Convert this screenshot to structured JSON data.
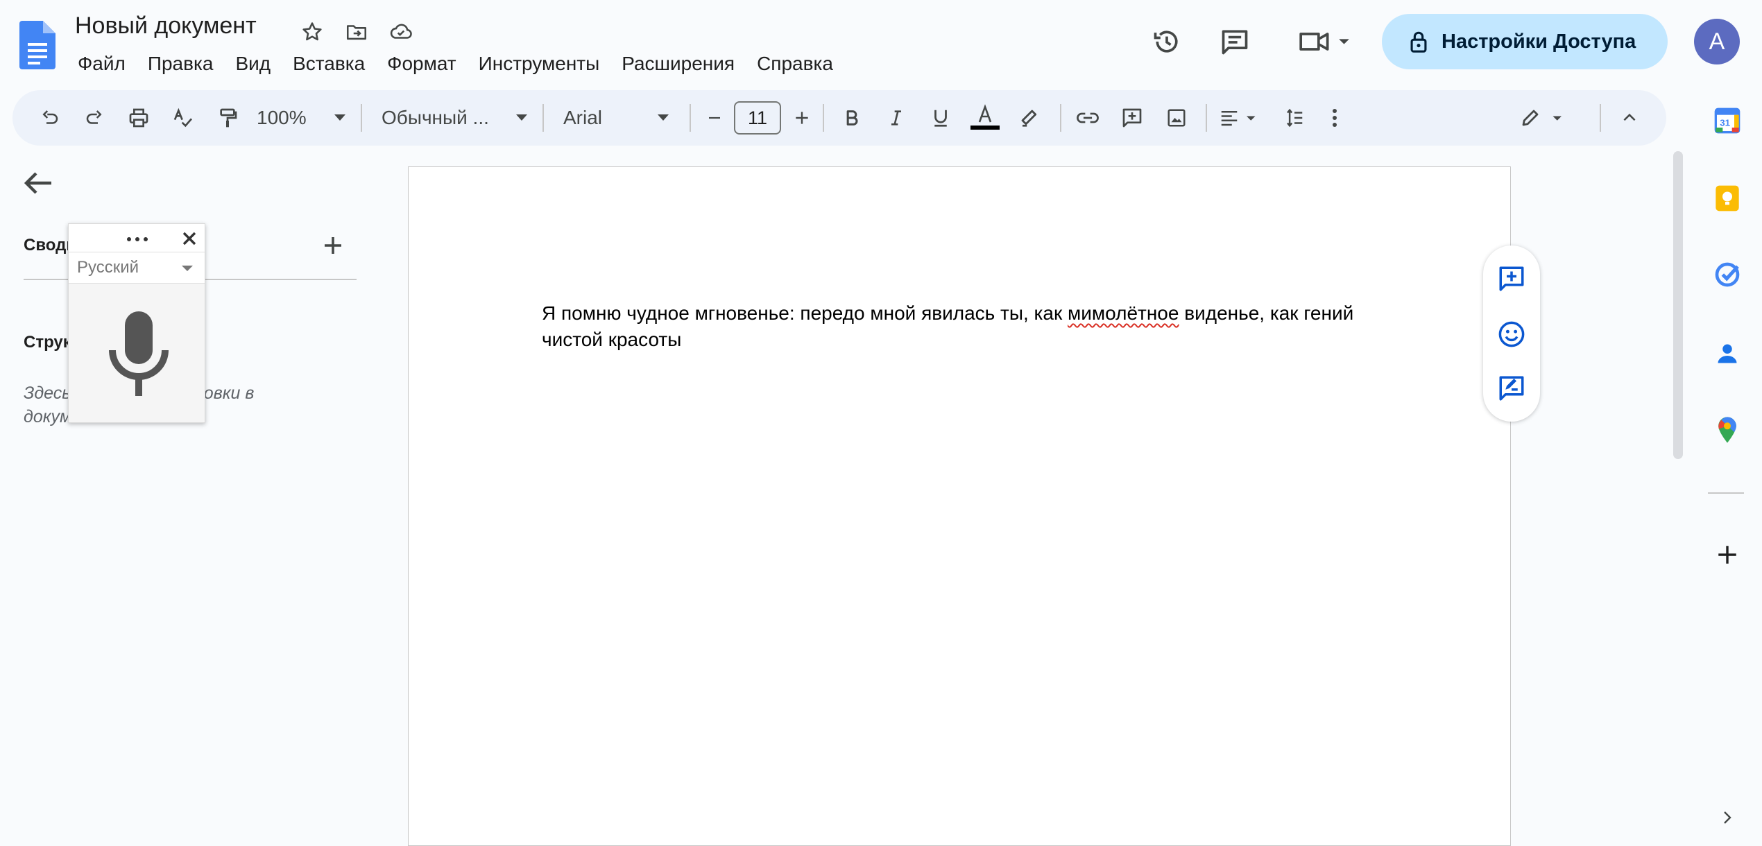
{
  "header": {
    "title": "Новый документ",
    "share_label": "Настройки Доступа",
    "avatar_letter": "A",
    "menu": [
      {
        "label": "Файл"
      },
      {
        "label": "Правка"
      },
      {
        "label": "Вид"
      },
      {
        "label": "Вставка"
      },
      {
        "label": "Формат"
      },
      {
        "label": "Инструменты"
      },
      {
        "label": "Расширения"
      },
      {
        "label": "Справка"
      }
    ],
    "icons": [
      "docs-logo-icon",
      "star-icon",
      "move-folder-icon",
      "cloud-saved-icon",
      "history-icon",
      "comments-icon",
      "meet-camera-icon",
      "lock-icon"
    ]
  },
  "toolbar": {
    "zoom": "100%",
    "style": "Обычный ...",
    "font": "Arial",
    "font_size": "11",
    "text_color": "#000000"
  },
  "outline": {
    "summary_label": "Сводка",
    "outline_label": "Структура",
    "hint": "Здесь появятся заголовки в документе."
  },
  "voice": {
    "language": "Русский"
  },
  "document": {
    "text_before": "Я помню чудное мгновенье: передо мной явилась ты, как ",
    "text_misspelled": "мимолётное",
    "text_after": " виденье, как гений чистой красоты"
  },
  "colors": {
    "accent": "#0b57d0",
    "share_bg": "#c2e7ff",
    "avatar_bg": "#5c6bc0",
    "docs_blue": "#4285f4"
  }
}
